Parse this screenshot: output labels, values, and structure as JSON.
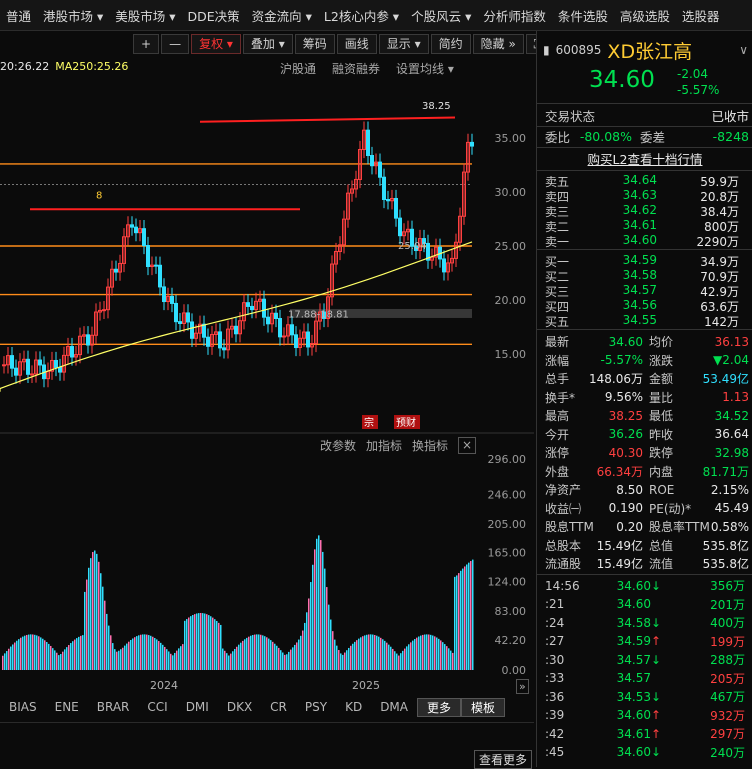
{
  "topbar": [
    "普通",
    "港股市场 ▾",
    "美股市场 ▾",
    "DDE决策",
    "资金流向 ▾",
    "L2核心内参 ▾",
    "个股风云 ▾",
    "分析师指数",
    "条件选股",
    "高级选股",
    "选股器"
  ],
  "toolbar": {
    "plus": "+",
    "minus": "—",
    "fuquan": "复权 ▾",
    "diejia": "叠加 ▾",
    "chouma": "筹码",
    "huaxian": "画线",
    "xianshi": "显示 ▾",
    "jianyue": "简约",
    "yincang": "隐藏 »"
  },
  "ma_legend": {
    "ma_a": "20:26.22",
    "ma250": "MA250:25.26"
  },
  "chart_tabs": [
    "沪股通",
    "融资融券",
    "设置均线 ▾"
  ],
  "y_axis": [
    "35.00",
    "30.00",
    "25.00",
    "20.00",
    "15.00"
  ],
  "annotations": {
    "high_label": "38.25",
    "low_label": "8",
    "range_label": "17.88-18.81",
    "mid_label": "25.04",
    "tag_zong": "宗",
    "tag_yucai": "预财"
  },
  "x_axis": [
    "2024",
    "2025"
  ],
  "vol_tabs": [
    "改参数",
    "加指标",
    "换指标"
  ],
  "vol_axis": [
    "296.00",
    "246.00",
    "205.00",
    "165.00",
    "124.00",
    "83.00",
    "42.20",
    "0.00"
  ],
  "indicators": [
    "BIAS",
    "ENE",
    "BRAR",
    "CCI",
    "DMI",
    "DKX",
    "CR",
    "PSY",
    "KD",
    "DMA",
    "更多",
    "模板"
  ],
  "more_btn": "查看更多",
  "stock": {
    "code": "600895",
    "name": "XD张江高",
    "price": "34.60",
    "change": "-2.04",
    "pct": "-5.57%"
  },
  "status": {
    "label": "交易状态",
    "value": "已收市"
  },
  "weibi": {
    "k1": "委比",
    "v1": "-80.08%",
    "k2": "委差",
    "v2": "-8248"
  },
  "l2link": "购买L2查看十档行情",
  "sells": [
    {
      "k": "卖五",
      "p": "34.64",
      "v": "59.9万"
    },
    {
      "k": "卖四",
      "p": "34.63",
      "v": "20.8万"
    },
    {
      "k": "卖三",
      "p": "34.62",
      "v": "38.4万"
    },
    {
      "k": "卖二",
      "p": "34.61",
      "v": "800万"
    },
    {
      "k": "卖一",
      "p": "34.60",
      "v": "2290万"
    }
  ],
  "buys": [
    {
      "k": "买一",
      "p": "34.59",
      "v": "34.9万"
    },
    {
      "k": "买二",
      "p": "34.58",
      "v": "70.9万"
    },
    {
      "k": "买三",
      "p": "34.57",
      "v": "42.9万"
    },
    {
      "k": "买四",
      "p": "34.56",
      "v": "63.6万"
    },
    {
      "k": "买五",
      "p": "34.55",
      "v": "142万"
    }
  ],
  "stats": [
    {
      "k1": "最新",
      "v1": "34.60",
      "c1": "g",
      "k2": "均价",
      "v2": "36.13",
      "c2": "r"
    },
    {
      "k1": "涨幅",
      "v1": "-5.57%",
      "c1": "g",
      "k2": "涨跌",
      "v2": "▼2.04",
      "c2": "g"
    },
    {
      "k1": "总手",
      "v1": "148.06万",
      "c1": "w",
      "k2": "金额",
      "v2": "53.49亿",
      "c2": "c"
    },
    {
      "k1": "换手*",
      "v1": "9.56%",
      "c1": "w",
      "k2": "量比",
      "v2": "1.13",
      "c2": "r"
    },
    {
      "k1": "最高",
      "v1": "38.25",
      "c1": "r",
      "k2": "最低",
      "v2": "34.52",
      "c2": "g"
    },
    {
      "k1": "今开",
      "v1": "36.26",
      "c1": "g",
      "k2": "昨收",
      "v2": "36.64",
      "c2": "w"
    },
    {
      "k1": "涨停",
      "v1": "40.30",
      "c1": "r",
      "k2": "跌停",
      "v2": "32.98",
      "c2": "g"
    },
    {
      "k1": "外盘",
      "v1": "66.34万",
      "c1": "r",
      "k2": "内盘",
      "v2": "81.71万",
      "c2": "g"
    },
    {
      "k1": "净资产",
      "v1": "8.50",
      "c1": "w",
      "k2": "ROE",
      "v2": "2.15%",
      "c2": "w"
    },
    {
      "k1": "收益㈠",
      "v1": "0.190",
      "c1": "w",
      "k2": "PE(动)*",
      "v2": "45.49",
      "c2": "w"
    },
    {
      "k1": "股息TTM",
      "v1": "0.20",
      "c1": "w",
      "k2": "股息率TTM",
      "v2": "0.58%",
      "c2": "w"
    },
    {
      "k1": "总股本",
      "v1": "15.49亿",
      "c1": "w",
      "k2": "总值",
      "v2": "535.8亿",
      "c2": "w"
    },
    {
      "k1": "流通股",
      "v1": "15.49亿",
      "c1": "w",
      "k2": "流值",
      "v2": "535.8亿",
      "c2": "w"
    }
  ],
  "ticks": [
    {
      "t": "14:56",
      "p": "34.60",
      "a": "↓",
      "v": "356万",
      "pc": "g",
      "vc": "g"
    },
    {
      "t": ":21",
      "p": "34.60",
      "a": "",
      "v": "201万",
      "pc": "g",
      "vc": "g"
    },
    {
      "t": ":24",
      "p": "34.58",
      "a": "↓",
      "v": "400万",
      "pc": "g",
      "vc": "g"
    },
    {
      "t": ":27",
      "p": "34.59",
      "a": "↑",
      "v": "199万",
      "pc": "g",
      "vc": "r"
    },
    {
      "t": ":30",
      "p": "34.57",
      "a": "↓",
      "v": "288万",
      "pc": "g",
      "vc": "g"
    },
    {
      "t": ":33",
      "p": "34.57",
      "a": "",
      "v": "205万",
      "pc": "g",
      "vc": "r"
    },
    {
      "t": ":36",
      "p": "34.53",
      "a": "↓",
      "v": "467万",
      "pc": "g",
      "vc": "g"
    },
    {
      "t": ":39",
      "p": "34.60",
      "a": "↑",
      "v": "932万",
      "pc": "g",
      "vc": "r"
    },
    {
      "t": ":42",
      "p": "34.61",
      "a": "↑",
      "v": "297万",
      "pc": "g",
      "vc": "r"
    },
    {
      "t": ":45",
      "p": "34.60",
      "a": "↓",
      "v": "240万",
      "pc": "g",
      "vc": "g"
    }
  ],
  "colors": {
    "up": "#ff4040",
    "down": "#00e050",
    "level_line": "#ff8c1a",
    "ma250": "#ffff66"
  }
}
